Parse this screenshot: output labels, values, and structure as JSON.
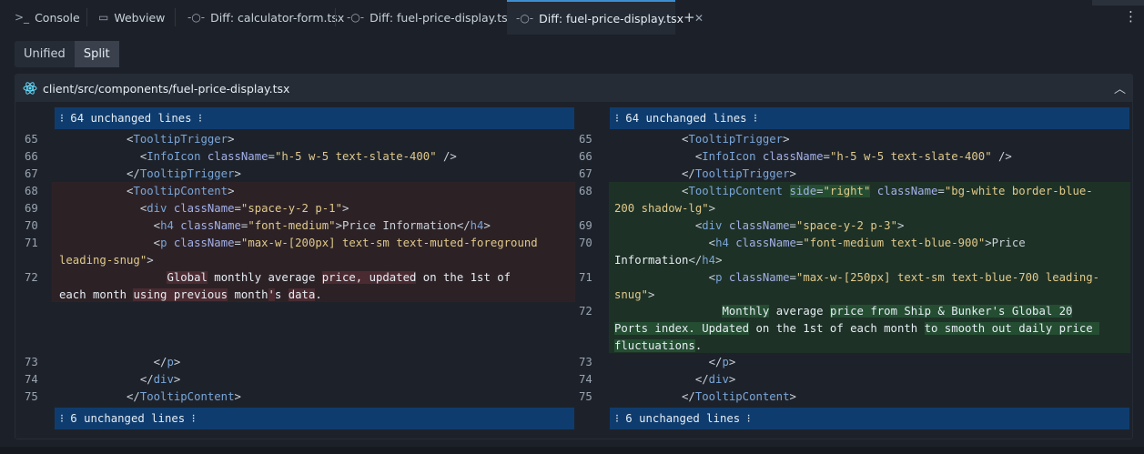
{
  "tabs": [
    {
      "label": "Console",
      "icon": "terminal-icon",
      "glyph": ">_"
    },
    {
      "label": "Webview",
      "icon": "monitor-icon",
      "glyph": "▭"
    },
    {
      "label": "Diff: calculator-form.tsx",
      "icon": "diff-icon",
      "glyph": "-○-"
    },
    {
      "label": "Diff: fuel-price-display.tsx",
      "icon": "diff-icon",
      "glyph": "-○-"
    },
    {
      "label": "Diff: fuel-price-display.tsx",
      "icon": "diff-icon",
      "glyph": "-○-",
      "active": true
    }
  ],
  "view_toggle": {
    "unified": "Unified",
    "split": "Split",
    "selected": "Split"
  },
  "file": {
    "path": "client/src/components/fuel-price-display.tsx"
  },
  "collapsed": {
    "top": "⁝ 64 unchanged lines ⁝",
    "bottom": "⁝ 6 unchanged lines ⁝"
  },
  "left": {
    "numbers": [
      "65",
      "66",
      "67",
      "68",
      "69",
      "70",
      "71",
      "72",
      "73",
      "74",
      "75"
    ]
  },
  "right": {
    "numbers": [
      "65",
      "66",
      "67",
      "68",
      "69",
      "70",
      "71",
      "72",
      "73",
      "74",
      "75"
    ]
  },
  "colors": {
    "accent": "#3d8fd1",
    "removed": "#2c2226",
    "added": "#1e3126",
    "collapsed": "#0f3c6e"
  }
}
